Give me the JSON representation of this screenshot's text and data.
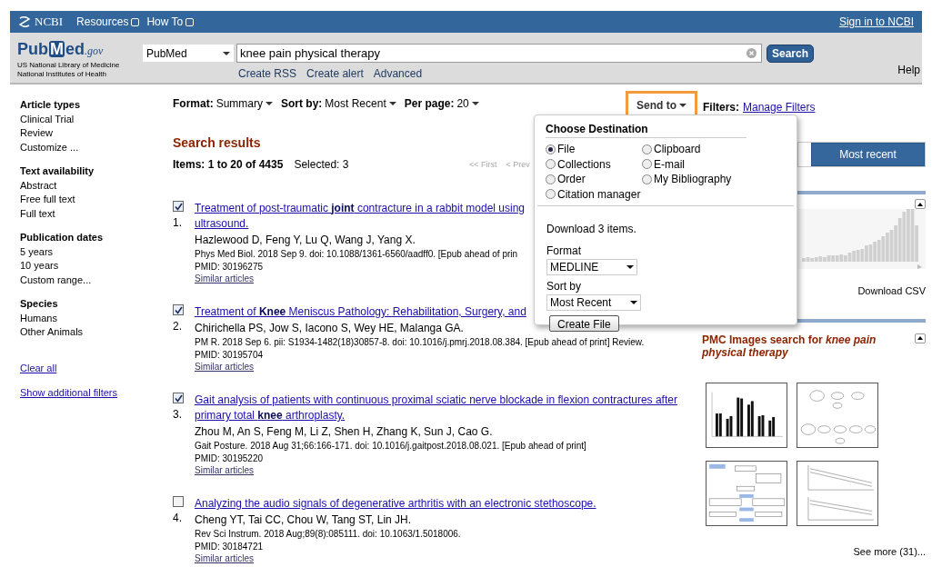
{
  "top_bar": {
    "brand": "NCBI",
    "menus": [
      {
        "label": "Resources"
      },
      {
        "label": "How To"
      }
    ],
    "sign_in": "Sign in to NCBI"
  },
  "header": {
    "logo": {
      "parts": [
        "Pub",
        "M",
        "ed"
      ],
      "domain": ".gov",
      "line1": "US National Library of Medicine",
      "line2": "National Institutes of Health"
    },
    "database": "PubMed",
    "query": "knee pain physical therapy",
    "search_button": "Search",
    "links": [
      "Create RSS",
      "Create alert",
      "Advanced"
    ],
    "help": "Help"
  },
  "sidebar": {
    "groups": [
      {
        "title": "Article types",
        "items": [
          "Clinical Trial",
          "Review",
          "Customize ..."
        ]
      },
      {
        "title": "Text availability",
        "items": [
          "Abstract",
          "Free full text",
          "Full text"
        ]
      },
      {
        "title": "Publication dates",
        "items": [
          "5 years",
          "10 years",
          "Custom range..."
        ]
      },
      {
        "title": "Species",
        "items": [
          "Humans",
          "Other Animals"
        ]
      }
    ],
    "links": [
      "Clear all",
      "Show additional filters"
    ]
  },
  "display_bar": [
    {
      "label": "Format:",
      "value": "Summary"
    },
    {
      "label": "Sort by:",
      "value": "Most Recent"
    },
    {
      "label": "Per page:",
      "value": "20"
    }
  ],
  "send_to": {
    "label": "Send to",
    "highlighted": true
  },
  "filters": {
    "label": "Filters:",
    "link": "Manage Filters"
  },
  "results": {
    "heading": "Search results",
    "items_count": "Items: 1 to 20 of 4435",
    "selected": "Selected: 3",
    "pager": [
      "<< First",
      "< Prev"
    ],
    "items": [
      {
        "number": "1.",
        "checked": true,
        "title_lines": [
          "Treatment of post-traumatic **joint** contracture in a rabbit model using",
          "ultrasound."
        ],
        "authors": "Hazlewood D, Feng Y, Lu Q, Wang J, Yang X.",
        "citation": "Phys Med Biol. 2018 Sep 9. doi: 10.1088/1361-6560/aadff0. [Epub ahead of prin",
        "pmid": "PMID: 30196275",
        "similar": "Similar articles"
      },
      {
        "number": "2.",
        "checked": true,
        "title_lines": [
          "Treatment of **Knee** Meniscus Pathology: Rehabilitation, Surgery, and"
        ],
        "authors": "Chirichella PS, Jow S, Iacono S, Wey HE, Malanga GA.",
        "citation": "PM R. 2018 Sep 6. pii: S1934-1482(18)30857-8. doi: 10.1016/j.pmrj.2018.08.384. [Epub ahead of print] Review.",
        "pmid": "PMID: 30195704",
        "similar": "Similar articles"
      },
      {
        "number": "3.",
        "checked": true,
        "title_lines": [
          "Gait analysis of patients with continuous proximal sciatic nerve blockade in flexion contractures after",
          "primary total **knee** arthroplasty."
        ],
        "authors": "Zhou M, An S, Feng M, Li Z, Shen H, Zhang K, Sun J, Cao G.",
        "citation": "Gait Posture. 2018 Aug 31;66:166-171. doi: 10.1016/j.gaitpost.2018.08.021. [Epub ahead of print]",
        "pmid": "PMID: 30195220",
        "similar": "Similar articles"
      },
      {
        "number": "4.",
        "checked": false,
        "title_lines": [
          "Analyzing the audio signals of degenerative arthritis with an electronic stethoscope."
        ],
        "authors": "Cheng YT, Tai CC, Chou W, Tang ST, Lin JH.",
        "citation": "Rev Sci Instrum. 2018 Aug;89(8):085111. doi: 10.1063/1.5018006.",
        "pmid": "PMID: 30184721",
        "similar": "Similar articles"
      }
    ]
  },
  "popup": {
    "title": "Choose Destination",
    "destinations": [
      {
        "label": "File",
        "selected": true
      },
      {
        "label": "Clipboard",
        "selected": false
      },
      {
        "label": "Collections",
        "selected": false
      },
      {
        "label": "E-mail",
        "selected": false
      },
      {
        "label": "Order",
        "selected": false
      },
      {
        "label": "My Bibliography",
        "selected": false
      },
      {
        "label": "Citation manager",
        "selected": false
      }
    ],
    "download_text": "Download 3 items.",
    "format_label": "Format",
    "format_value": "MEDLINE",
    "sort_label": "Sort by",
    "sort_value": "Most Recent",
    "button": "Create File"
  },
  "right_column": {
    "sort_tab": {
      "label": "Most recent",
      "selected": true
    },
    "download_csv": "Download CSV",
    "pmc_title": "PMC Images search for *knee pain physical therapy*",
    "see_more": "See more (31)..."
  }
}
